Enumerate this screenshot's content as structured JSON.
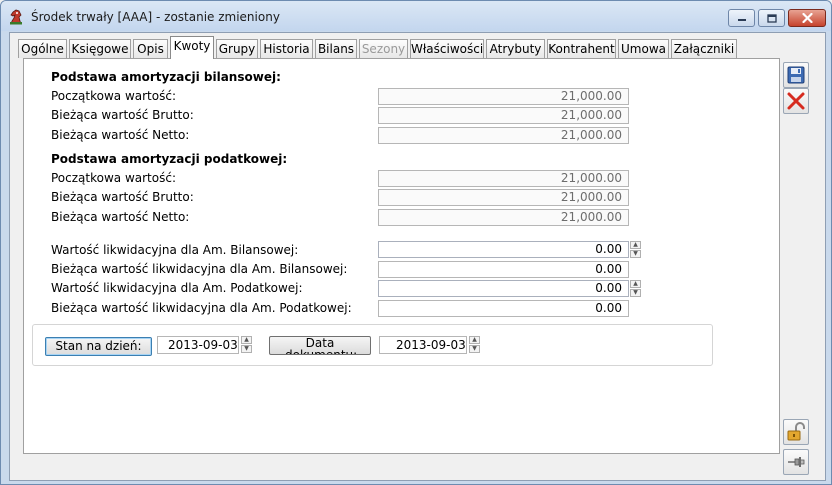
{
  "window": {
    "title": "Środek trwały [AAA] - zostanie zmieniony"
  },
  "tabs": [
    {
      "label": "Ogólne",
      "state": "normal"
    },
    {
      "label": "Księgowe",
      "state": "normal"
    },
    {
      "label": "Opis",
      "state": "normal"
    },
    {
      "label": "Kwoty",
      "state": "active"
    },
    {
      "label": "Grupy",
      "state": "normal"
    },
    {
      "label": "Historia",
      "state": "normal"
    },
    {
      "label": "Bilans",
      "state": "normal"
    },
    {
      "label": "Sezony",
      "state": "disabled"
    },
    {
      "label": "Właściwości",
      "state": "normal"
    },
    {
      "label": "Atrybuty",
      "state": "normal"
    },
    {
      "label": "Kontrahent",
      "state": "normal"
    },
    {
      "label": "Umowa",
      "state": "normal"
    },
    {
      "label": "Załączniki",
      "state": "normal"
    }
  ],
  "bilansowa": {
    "heading": "Podstawa amortyzacji bilansowej:",
    "rows": [
      {
        "label": "Początkowa wartość:",
        "value": "21,000.00"
      },
      {
        "label": "Bieżąca wartość Brutto:",
        "value": "21,000.00"
      },
      {
        "label": "Bieżąca wartość Netto:",
        "value": "21,000.00"
      }
    ]
  },
  "podatkowa": {
    "heading": "Podstawa amortyzacji podatkowej:",
    "rows": [
      {
        "label": "Początkowa wartość:",
        "value": "21,000.00"
      },
      {
        "label": "Bieżąca wartość Brutto:",
        "value": "21,000.00"
      },
      {
        "label": "Bieżąca wartość Netto:",
        "value": "21,000.00"
      }
    ]
  },
  "likwidacyjna": {
    "rows": [
      {
        "label": "Wartość likwidacyjna dla Am. Bilansowej:",
        "value": "0.00"
      },
      {
        "label": "Bieżąca wartość likwidacyjna dla Am. Bilansowej:",
        "value": "0.00"
      },
      {
        "label": "Wartość likwidacyjna dla Am. Podatkowej:",
        "value": "0.00"
      },
      {
        "label": "Bieżąca wartość likwidacyjna dla Am. Podatkowej:",
        "value": "0.00"
      }
    ]
  },
  "dates": {
    "stan_button": "Stan na dzień:",
    "stan_value": "2013-09-03",
    "dokument_button": "Data dokumentu:",
    "dokument_value": "2013-09-03"
  },
  "icons": {
    "app": "chess-knight-icon",
    "save": "floppy-disk-icon",
    "cancel": "red-x-icon",
    "lock": "padlock-open-icon",
    "pin": "pin-icon"
  }
}
